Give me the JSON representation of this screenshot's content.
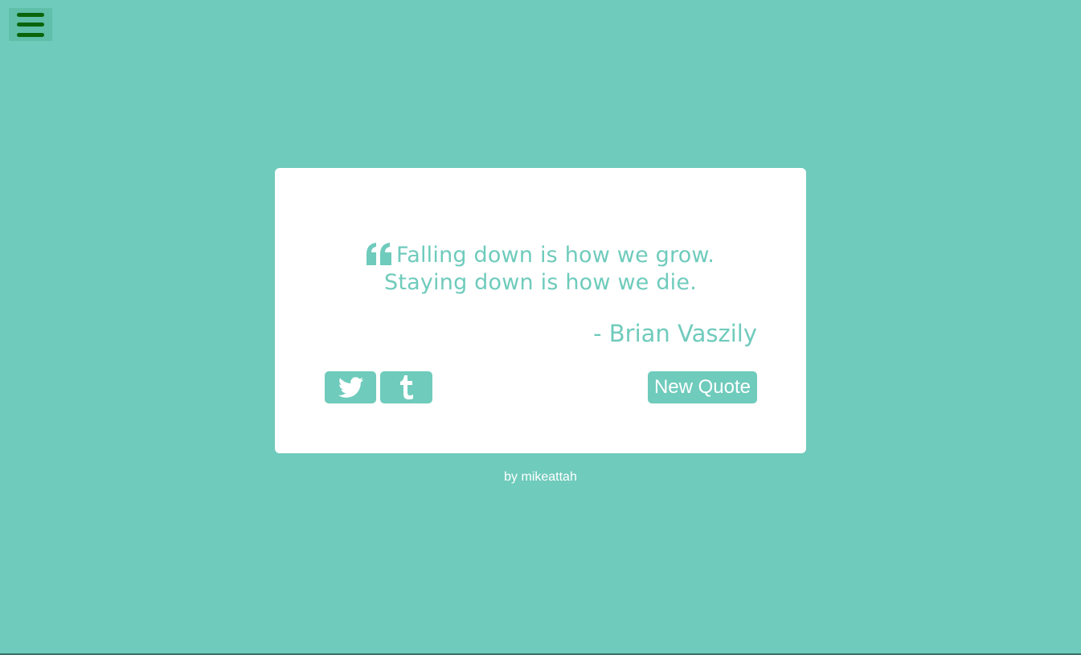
{
  "menu": {
    "icon": "hamburger-menu-icon"
  },
  "quote": {
    "icon": "quote-left-icon",
    "text": "Falling down is how we grow. Staying down is how we die.",
    "author": "- Brian Vaszily"
  },
  "actions": {
    "twitter_icon": "twitter-icon",
    "tumblr_icon": "tumblr-icon",
    "new_quote_label": "New Quote"
  },
  "footer": {
    "credit": "by mikeattah"
  },
  "colors": {
    "background": "#6fcbbc",
    "card": "#ffffff",
    "accent": "#6fcbbc",
    "menu_icon": "#0a650a"
  }
}
